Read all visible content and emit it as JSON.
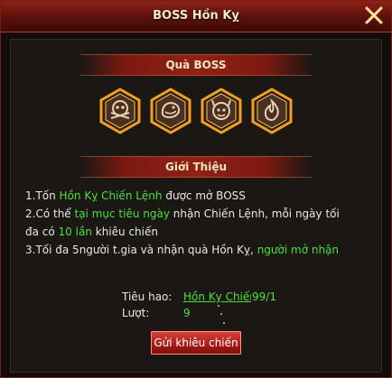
{
  "window": {
    "title": "BOSS Hồn Kỵ"
  },
  "rewards_section": {
    "header": "Quà BOSS",
    "items": [
      {
        "icon": "skull-crossbones-icon"
      },
      {
        "icon": "dragon-head-icon"
      },
      {
        "icon": "demon-face-icon"
      },
      {
        "icon": "flame-orb-icon"
      }
    ]
  },
  "intro_section": {
    "header": "Giới Thiệu",
    "line1": {
      "prefix": "1.Tốn ",
      "highlight": "Hồn Kỵ Chiến Lệnh",
      "suffix": " được mở BOSS"
    },
    "line2": {
      "prefix": "2.Có thể ",
      "highlight": "tại mục tiêu ngày",
      "suffix": " nhận Chiến Lệnh, mỗi ngày tối"
    },
    "line2b": {
      "prefix": "đa có ",
      "highlight": "10 lần",
      "suffix": " khiêu chiến"
    },
    "line3": {
      "prefix": "3.Tối đa 5người t.gia và nhận quà Hồn Kỵ, ",
      "highlight": "người mở nhận"
    }
  },
  "stats": {
    "cost_label": "Tiêu hao:",
    "cost_item": "Hồn Kỵ Chiến Lệnh",
    "cost_count": "99/1",
    "turns_label": "Lượt:",
    "turns_value": "9"
  },
  "actions": {
    "challenge_button": "Gửi khiêu chiến"
  },
  "colors": {
    "accent_green": "#4ce03c",
    "title_red": "#8d2116",
    "button_red": "#c22c24",
    "gold": "#e8a020"
  }
}
